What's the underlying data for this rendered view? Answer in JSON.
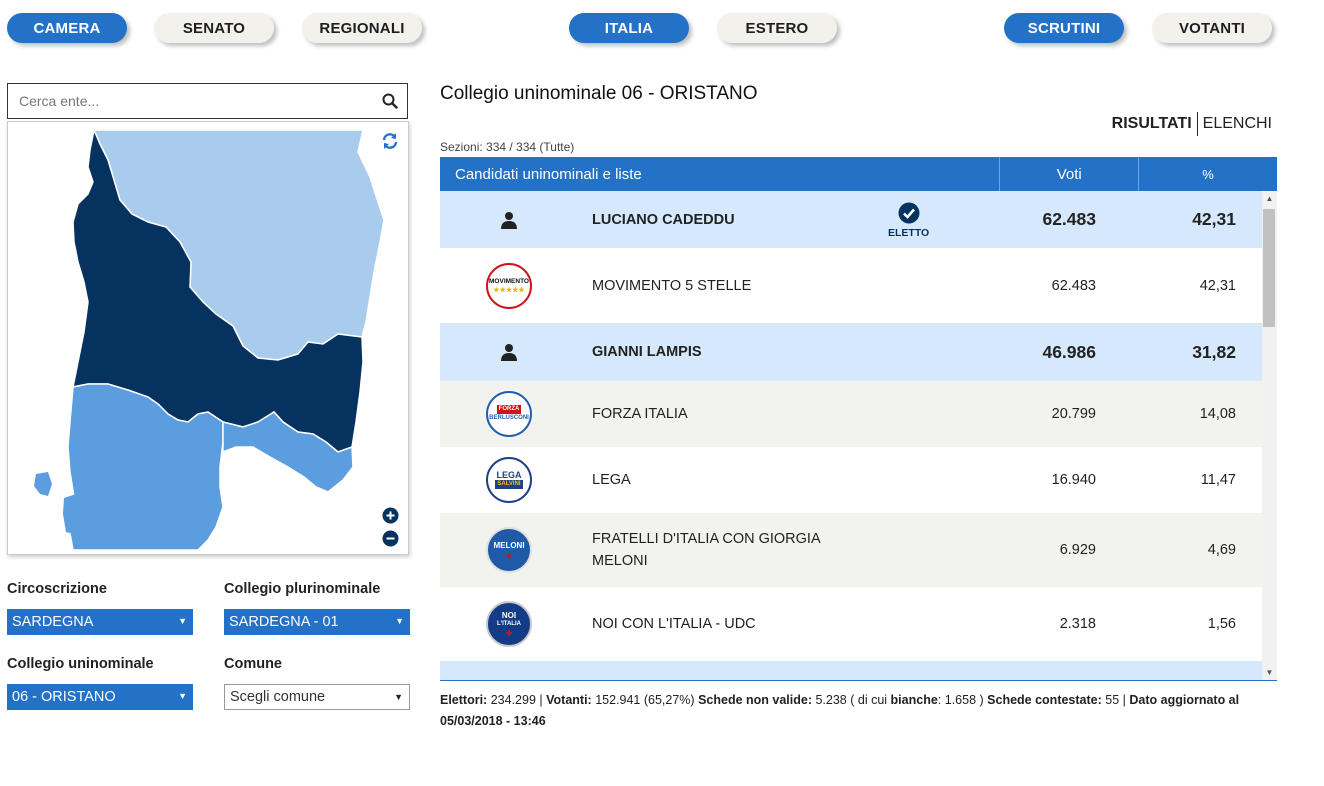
{
  "top_nav": {
    "camera": "CAMERA",
    "senato": "SENATO",
    "regionali": "REGIONALI",
    "italia": "ITALIA",
    "estero": "ESTERO",
    "scrutini": "SCRUTINI",
    "votanti": "VOTANTI"
  },
  "search": {
    "placeholder": "Cerca ente..."
  },
  "filters": {
    "circoscrizione_label": "Circoscrizione",
    "circoscrizione_value": "SARDEGNA",
    "plurinominale_label": "Collegio plurinominale",
    "plurinominale_value": "SARDEGNA - 01",
    "uninominale_label": "Collegio uninominale",
    "uninominale_value": "06 - ORISTANO",
    "comune_label": "Comune",
    "comune_value": "Scegli comune"
  },
  "main": {
    "title": "Collegio uninominale 06 - ORISTANO",
    "tab_risultati": "RISULTATI",
    "tab_elenchi": "ELENCHI",
    "sezioni": "Sezioni: 334 / 334 (Tutte)"
  },
  "table": {
    "col_candidati": "Candidati uninominali e liste",
    "col_voti": "Voti",
    "col_pct": "%",
    "eletto_label": "ELETTO",
    "rows": [
      {
        "name": "LUCIANO CADEDDU",
        "votes": "62.483",
        "pct": "42,31"
      },
      {
        "name": "MOVIMENTO 5 STELLE",
        "votes": "62.483",
        "pct": "42,31",
        "logo_text": "MOVIMENTO"
      },
      {
        "name": "GIANNI LAMPIS",
        "votes": "46.986",
        "pct": "31,82"
      },
      {
        "name": "FORZA ITALIA",
        "votes": "20.799",
        "pct": "14,08",
        "logo_text": "BERLUSCONI"
      },
      {
        "name": "LEGA",
        "votes": "16.940",
        "pct": "11,47",
        "logo_text": "LEGA",
        "logo_sub": "SALVINI"
      },
      {
        "name": "FRATELLI D'ITALIA CON GIORGIA MELONI",
        "votes": "6.929",
        "pct": "4,69",
        "logo_text": "MELONI"
      },
      {
        "name": "NOI CON L'ITALIA - UDC",
        "votes": "2.318",
        "pct": "1,56",
        "logo_text": "NOI",
        "logo_sub": "L'ITALIA"
      }
    ]
  },
  "footer": {
    "elettori_label": "Elettori:",
    "elettori_value": "234.299",
    "votanti_label": "Votanti:",
    "votanti_value": "152.941 (65,27%)",
    "non_valide_label": "Schede non valide:",
    "non_valide_value": "5.238",
    "di_cui": "( di cui",
    "bianche_label": "bianche",
    "bianche_value": ": 1.658 )",
    "contestate_label": "Schede contestate:",
    "contestate_value": "55",
    "aggiornato": "Dato aggiornato al 05/03/2018 - 13:46"
  },
  "colors": {
    "accent": "#2372c7",
    "map_selected": "#06325f",
    "map_light": "#a9cbec",
    "map_medium": "#5c9ddf",
    "row_highlight": "#d6e8fb",
    "row_alt": "#f2f2ee"
  }
}
